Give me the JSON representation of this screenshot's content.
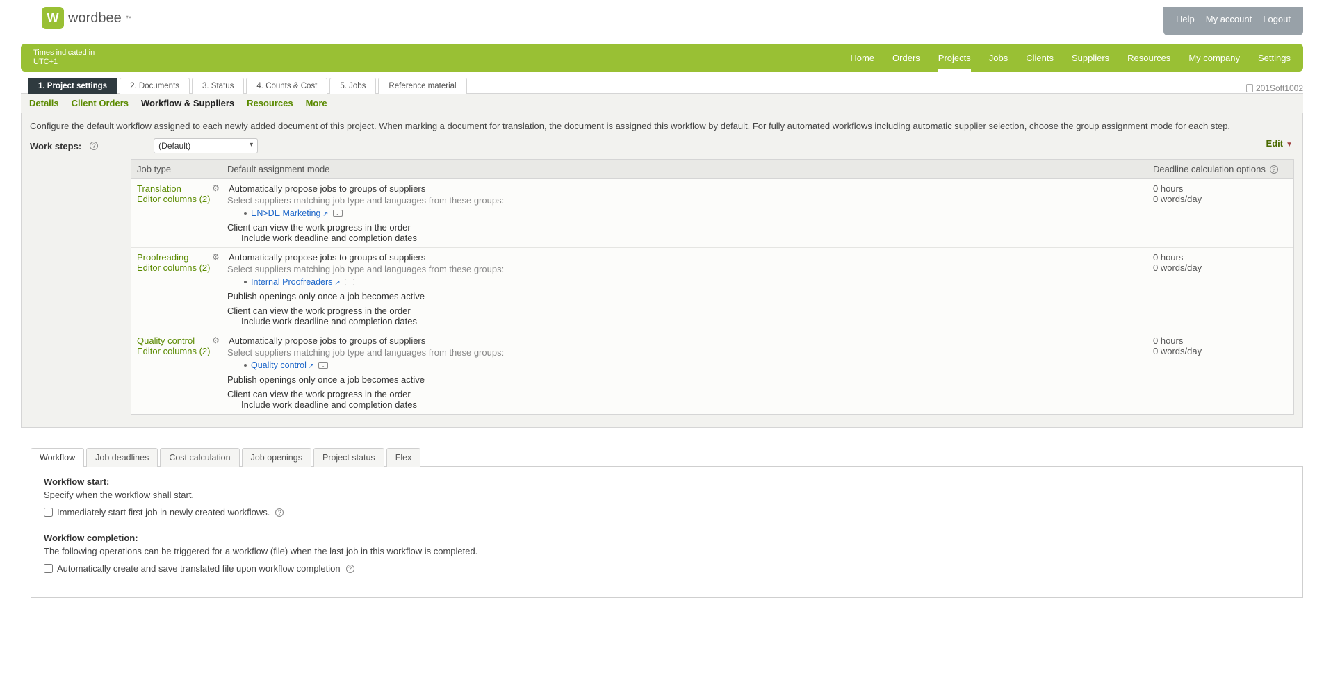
{
  "logo_text": "wordbee",
  "logo_tm": "™",
  "account_links": {
    "help": "Help",
    "my_account": "My account",
    "logout": "Logout"
  },
  "nav_left_line1": "Times indicated in",
  "nav_left_line2": "UTC+1",
  "nav_items": [
    "Home",
    "Orders",
    "Projects",
    "Jobs",
    "Clients",
    "Suppliers",
    "Resources",
    "My company",
    "Settings"
  ],
  "nav_active_index": 2,
  "page_tabs": [
    "1. Project settings",
    "2. Documents",
    "3. Status",
    "4. Counts & Cost",
    "5. Jobs",
    "Reference material"
  ],
  "page_tab_active_index": 0,
  "project_id": "201Soft1002",
  "sub_tabs": [
    "Details",
    "Client Orders",
    "Workflow & Suppliers",
    "Resources",
    "More"
  ],
  "sub_tab_active_index": 2,
  "description": "Configure the default workflow assigned to each newly added document of this project. When marking a document for translation, the document is assigned this workflow by default. For fully automated workflows including automatic supplier selection, choose the group assignment mode for each step.",
  "edit_label": "Edit",
  "worksteps_label": "Work steps:",
  "worksteps_selected": "(Default)",
  "grid_headers": {
    "job": "Job type",
    "mode": "Default assignment mode",
    "deadline": "Deadline calculation options"
  },
  "rows": [
    {
      "jobtype": "Translation",
      "editorcols": "Editor columns (2)",
      "mode_title": "Automatically propose jobs to groups of suppliers",
      "mode_sub": "Select suppliers matching job type and languages from these groups:",
      "group_link": "EN>DE Marketing",
      "publish_line": "",
      "client_line": "Client can view the work progress in the order",
      "include_line": "Include work deadline and completion dates",
      "dead1": "0 hours",
      "dead2": "0 words/day"
    },
    {
      "jobtype": "Proofreading",
      "editorcols": "Editor columns (2)",
      "mode_title": "Automatically propose jobs to groups of suppliers",
      "mode_sub": "Select suppliers matching job type and languages from these groups:",
      "group_link": "Internal Proofreaders",
      "publish_line": "Publish openings only once a job becomes active",
      "client_line": "Client can view the work progress in the order",
      "include_line": "Include work deadline and completion dates",
      "dead1": "0 hours",
      "dead2": "0 words/day"
    },
    {
      "jobtype": "Quality control",
      "editorcols": "Editor columns (2)",
      "mode_title": "Automatically propose jobs to groups of suppliers",
      "mode_sub": "Select suppliers matching job type and languages from these groups:",
      "group_link": "Quality control",
      "publish_line": "Publish openings only once a job becomes active",
      "client_line": "Client can view the work progress in the order",
      "include_line": "Include work deadline and completion dates",
      "dead1": "0 hours",
      "dead2": "0 words/day"
    }
  ],
  "lower_tabs": [
    "Workflow",
    "Job deadlines",
    "Cost calculation",
    "Job openings",
    "Project status",
    "Flex"
  ],
  "lower_tab_active_index": 0,
  "wf_start_title": "Workflow start:",
  "wf_start_text": "Specify when the workflow shall start.",
  "chk1_label": "Immediately start first job in newly created workflows.",
  "wf_comp_title": "Workflow completion:",
  "wf_comp_text": "The following operations can be triggered for a workflow (file) when the last job in this workflow is completed.",
  "chk2_label": "Automatically create and save translated file upon workflow completion"
}
